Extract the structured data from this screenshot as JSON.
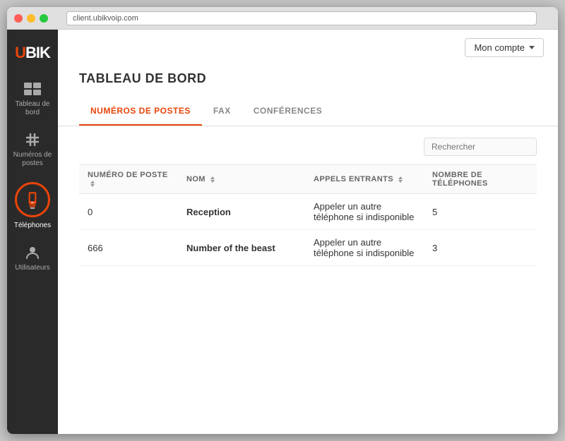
{
  "window": {
    "url": "client.ubikvoip.com"
  },
  "header": {
    "account_button": "Mon compte",
    "page_title": "TABLEAU DE BORD"
  },
  "sidebar": {
    "logo": "UBIK",
    "items": [
      {
        "id": "tableau-de-bord",
        "label": "Tableau de bord",
        "active": false
      },
      {
        "id": "numeros-de-postes",
        "label": "Numéros de postes",
        "active": false
      },
      {
        "id": "telephones",
        "label": "Téléphones",
        "active": true
      },
      {
        "id": "utilisateurs",
        "label": "Utilisateurs",
        "active": false
      }
    ]
  },
  "tabs": [
    {
      "id": "numeros",
      "label": "NUMÉROS DE POSTES",
      "active": true
    },
    {
      "id": "fax",
      "label": "FAX",
      "active": false
    },
    {
      "id": "conferences",
      "label": "CONFÉRENCES",
      "active": false
    }
  ],
  "search": {
    "placeholder": "Rechercher"
  },
  "table": {
    "columns": [
      {
        "id": "numero",
        "label": "NUMÉRO DE POSTE",
        "sortable": true
      },
      {
        "id": "nom",
        "label": "NOM",
        "sortable": true
      },
      {
        "id": "appels",
        "label": "APPELS ENTRANTS",
        "sortable": true
      },
      {
        "id": "telephones",
        "label": "NOMBRE DE TÉLÉPHONES",
        "sortable": false
      }
    ],
    "rows": [
      {
        "numero": "0",
        "nom": "Reception",
        "appels": "Appeler un autre téléphone si indisponible",
        "telephones": "5"
      },
      {
        "numero": "666",
        "nom": "Number of the beast",
        "appels": "Appeler un autre téléphone si indisponible",
        "telephones": "3"
      }
    ]
  }
}
